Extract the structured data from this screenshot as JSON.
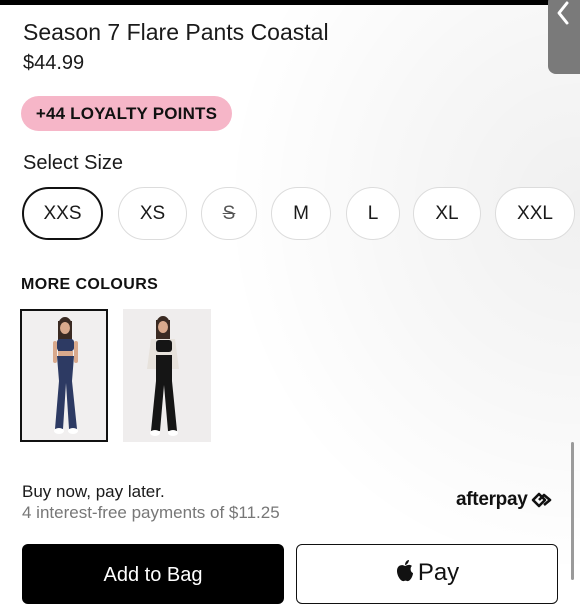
{
  "product": {
    "title": "Season 7 Flare Pants Coastal",
    "price": "$44.99",
    "loyalty_badge": "+44 LOYALTY POINTS"
  },
  "size_selector": {
    "label": "Select Size",
    "options": [
      {
        "label": "XXS",
        "selected": true,
        "available": true
      },
      {
        "label": "XS",
        "selected": false,
        "available": true
      },
      {
        "label": "S",
        "selected": false,
        "available": false
      },
      {
        "label": "M",
        "selected": false,
        "available": true
      },
      {
        "label": "L",
        "selected": false,
        "available": true
      },
      {
        "label": "XL",
        "selected": false,
        "available": true
      },
      {
        "label": "XXL",
        "selected": false,
        "available": true
      }
    ]
  },
  "colours": {
    "heading": "MORE COLOURS",
    "swatches": [
      {
        "colour": "#2d3a63",
        "selected": true
      },
      {
        "colour": "#111111",
        "selected": false
      }
    ]
  },
  "payment": {
    "headline": "Buy now, pay later.",
    "installments": "4 interest-free payments of $11.25",
    "provider": "afterpay",
    "provider_icon": "afterpay-arrows-icon"
  },
  "actions": {
    "add_to_bag": "Add to Bag",
    "apple_pay": "Pay"
  },
  "colors": {
    "loyalty_badge": "#f6b6c8",
    "primary": "#000000"
  }
}
